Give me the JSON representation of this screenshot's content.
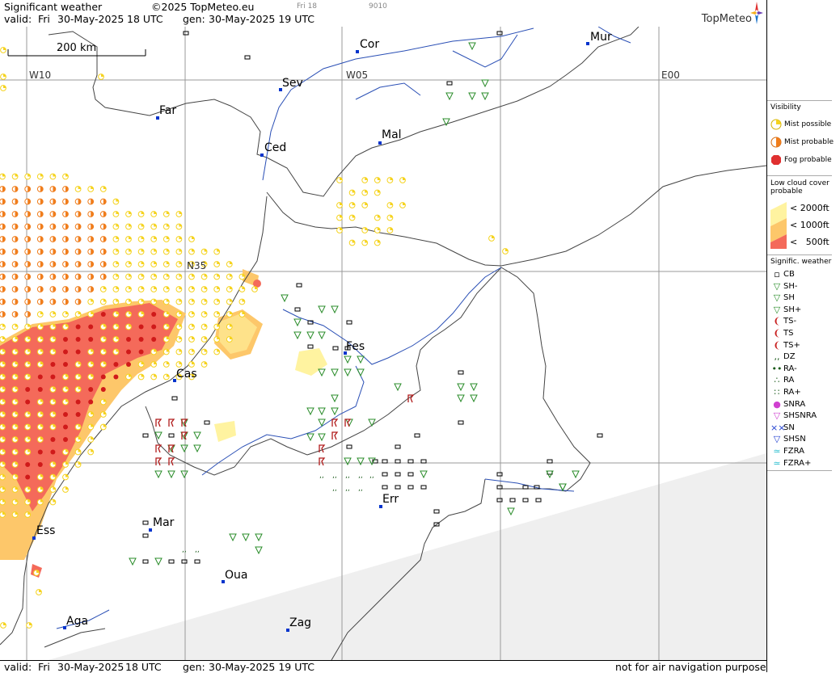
{
  "header": {
    "title": "Significant weather",
    "copyright": "©2025 TopMeteo.eu",
    "frame_label": "Fri 18",
    "code": "9010",
    "valid_label": "valid:",
    "valid_day": "Fri",
    "valid_date": "30-May-2025",
    "valid_time": "18 UTC",
    "gen_label": "gen:",
    "gen_datetime": "30-May-2025 19 UTC",
    "brand": "TopMeteo"
  },
  "footer": {
    "valid_label": "valid:",
    "valid_day": "Fri",
    "valid_date": "30-May-2025",
    "valid_time": "18 UTC",
    "gen_label": "gen:",
    "gen_datetime": "30-May-2025 19 UTC",
    "disclaimer": "not for air navigation purposes"
  },
  "map": {
    "scale_label": "200 km",
    "grid_labels": [
      "W10",
      "W05",
      "E00",
      "N35"
    ],
    "cities": [
      "Cor",
      "Mur",
      "Sev",
      "Far",
      "Mal",
      "Ced",
      "Fes",
      "Cas",
      "Err",
      "Mar",
      "Ess",
      "Oua",
      "Aga",
      "Zag"
    ]
  },
  "legend": {
    "visibility_title": "Visibility",
    "visibility_items": [
      "Mist possible",
      "Mist probable",
      "Fog probable"
    ],
    "lowcloud_title": "Low cloud cover probable",
    "lowcloud_items": [
      "< 2000ft",
      "< 1000ft",
      "<   500ft"
    ],
    "sigwx_title": "Signific. weather",
    "sigwx_items": [
      "CB",
      "SH-",
      "SH",
      "SH+",
      "TS-",
      "TS",
      "TS+",
      "DZ",
      "RA-",
      "RA",
      "RA+",
      "SNRA",
      "SHSNRA",
      "SN",
      "SHSN",
      "FZRA",
      "FZRA+"
    ],
    "colors": {
      "mist_possible": "#f5d31f",
      "mist_probable": "#f07d1c",
      "fog_probable": "#e03030",
      "cloud_2000": "#fff3a0",
      "cloud_1000": "#fdc76a",
      "cloud_500": "#f46a5a"
    }
  }
}
